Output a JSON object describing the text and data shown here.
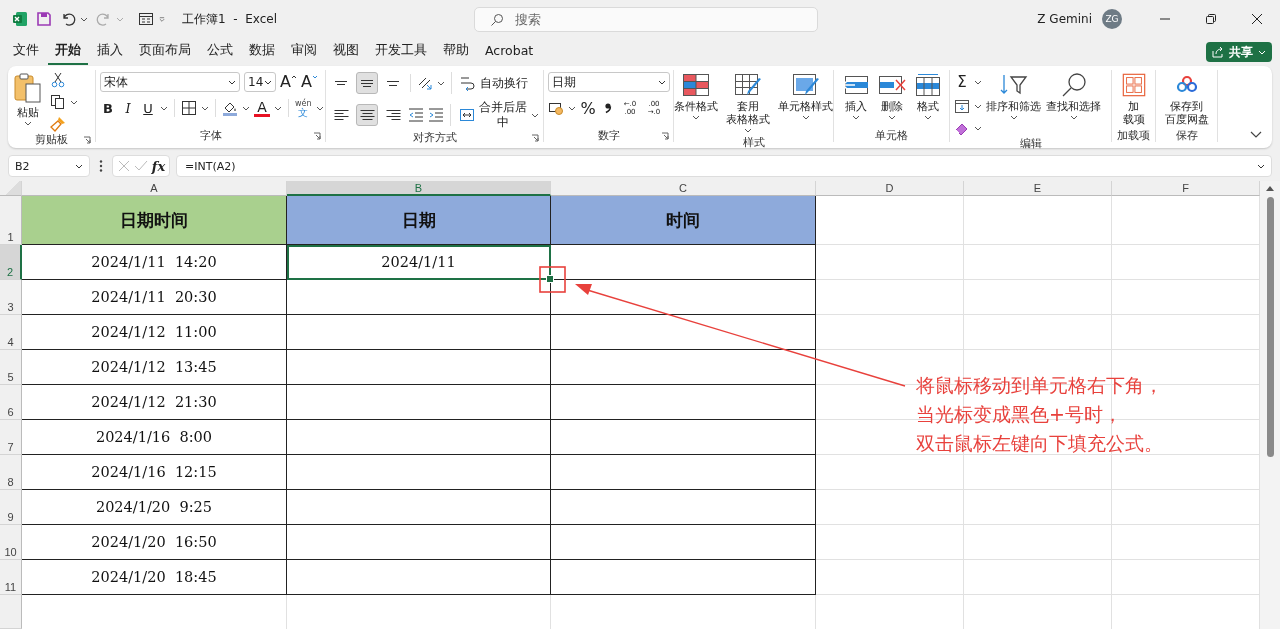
{
  "title_bar": {
    "title": "工作簿1  -  Excel",
    "search": {
      "placeholder": "搜索"
    },
    "user_name": "Z Gemini",
    "avatar_initials": "ZG"
  },
  "menu_tabs": [
    {
      "label": "文件",
      "selected": false
    },
    {
      "label": "开始",
      "selected": true
    },
    {
      "label": "插入",
      "selected": false
    },
    {
      "label": "页面布局",
      "selected": false
    },
    {
      "label": "公式",
      "selected": false
    },
    {
      "label": "数据",
      "selected": false
    },
    {
      "label": "审阅",
      "selected": false
    },
    {
      "label": "视图",
      "selected": false
    },
    {
      "label": "开发工具",
      "selected": false
    },
    {
      "label": "帮助",
      "selected": false
    },
    {
      "label": "Acrobat",
      "selected": false
    }
  ],
  "share_button": {
    "label": "共享"
  },
  "ribbon": {
    "clipboard": {
      "paste": "粘贴",
      "group_label": "剪贴板"
    },
    "font": {
      "font_name": "宋体",
      "font_size": "14",
      "grow_font": "A",
      "shrink_font": "A",
      "bold": "B",
      "italic": "I",
      "underline": "U",
      "font_color": "A",
      "phonetic_top": "wén",
      "phonetic_bottom": "文",
      "group_label": "字体"
    },
    "alignment": {
      "vertical_buttons": [
        {
          "selected": false
        },
        {
          "selected": true
        },
        {
          "selected": false
        }
      ],
      "horizontal_buttons": [
        {
          "selected": false
        },
        {
          "selected": true
        },
        {
          "selected": false
        }
      ],
      "wrap_text": "自动换行",
      "merge_center": "合并后居中",
      "group_label": "对齐方式"
    },
    "number": {
      "format": "日期",
      "percent": "%",
      "increase_decimal": [
        "←.0",
        ".00"
      ],
      "decrease_decimal": [
        ".00",
        "→.0"
      ],
      "group_label": "数字"
    },
    "styles": {
      "conditional_formatting": "条件格式",
      "format_as_table": [
        "套用",
        "表格格式"
      ],
      "cell_styles": "单元格样式",
      "group_label": "样式"
    },
    "cells": {
      "insert": "插入",
      "delete": "删除",
      "format": "格式",
      "group_label": "单元格"
    },
    "editing": {
      "autosum": "Σ",
      "sort_filter": "排序和筛选",
      "find_select": "查找和选择",
      "group_label": "编辑"
    },
    "addins": {
      "addins_button": [
        "加",
        "载项"
      ],
      "group_label": "加载项"
    },
    "save": {
      "save_button": [
        "保存到",
        "百度网盘"
      ],
      "group_label": "保存"
    }
  },
  "formula_bar": {
    "name_box": "B2",
    "fx": "fx",
    "formula": "=INT(A2)"
  },
  "sheet": {
    "columns": [
      {
        "label": "A",
        "selected": false
      },
      {
        "label": "B",
        "selected": true
      },
      {
        "label": "C",
        "selected": false
      },
      {
        "label": "D",
        "selected": false
      },
      {
        "label": "E",
        "selected": false
      },
      {
        "label": "F",
        "selected": false
      }
    ],
    "rows": [
      {
        "number": "1",
        "selected": false,
        "cells": [
          {
            "text": "日期时间",
            "color": "#a9d08e",
            "selected": false
          },
          {
            "text": "日期",
            "color": "#8eaadb",
            "selected": false
          },
          {
            "text": "时间",
            "color": "#8eaadb",
            "selected": false
          }
        ]
      },
      {
        "number": "2",
        "selected": true,
        "cells": [
          {
            "text": "2024/1/11  14:20",
            "selected": false
          },
          {
            "text": "2024/1/11",
            "selected": true
          },
          {
            "selected": false
          }
        ]
      },
      {
        "number": "3",
        "selected": false,
        "cells": [
          {
            "text": "2024/1/11  20:30",
            "selected": false
          },
          {
            "selected": false
          },
          {
            "selected": false
          }
        ]
      },
      {
        "number": "4",
        "selected": false,
        "cells": [
          {
            "text": "2024/1/12  11:00",
            "selected": false
          },
          {
            "selected": false
          },
          {
            "selected": false
          }
        ]
      },
      {
        "number": "5",
        "selected": false,
        "cells": [
          {
            "text": "2024/1/12  13:45",
            "selected": false
          },
          {
            "selected": false
          },
          {
            "selected": false
          }
        ]
      },
      {
        "number": "6",
        "selected": false,
        "cells": [
          {
            "text": "2024/1/12  21:30",
            "selected": false
          },
          {
            "selected": false
          },
          {
            "selected": false
          }
        ]
      },
      {
        "number": "7",
        "selected": false,
        "cells": [
          {
            "text": "2024/1/16  8:00",
            "selected": false
          },
          {
            "selected": false
          },
          {
            "selected": false
          }
        ]
      },
      {
        "number": "8",
        "selected": false,
        "cells": [
          {
            "text": "2024/1/16  12:15",
            "selected": false
          },
          {
            "selected": false
          },
          {
            "selected": false
          }
        ]
      },
      {
        "number": "9",
        "selected": false,
        "cells": [
          {
            "text": "2024/1/20  9:25",
            "selected": false
          },
          {
            "selected": false
          },
          {
            "selected": false
          }
        ]
      },
      {
        "number": "10",
        "selected": false,
        "cells": [
          {
            "text": "2024/1/20  16:50",
            "selected": false
          },
          {
            "selected": false
          },
          {
            "selected": false
          }
        ]
      },
      {
        "number": "11",
        "selected": false,
        "cells": [
          {
            "text": "2024/1/20  18:45",
            "selected": false
          },
          {
            "selected": false
          },
          {
            "selected": false
          }
        ]
      }
    ]
  },
  "annotation": {
    "lines": [
      "将鼠标移动到单元格右下角，",
      "当光标变成黑色+号时，",
      "双击鼠标左键向下填充公式。"
    ]
  }
}
